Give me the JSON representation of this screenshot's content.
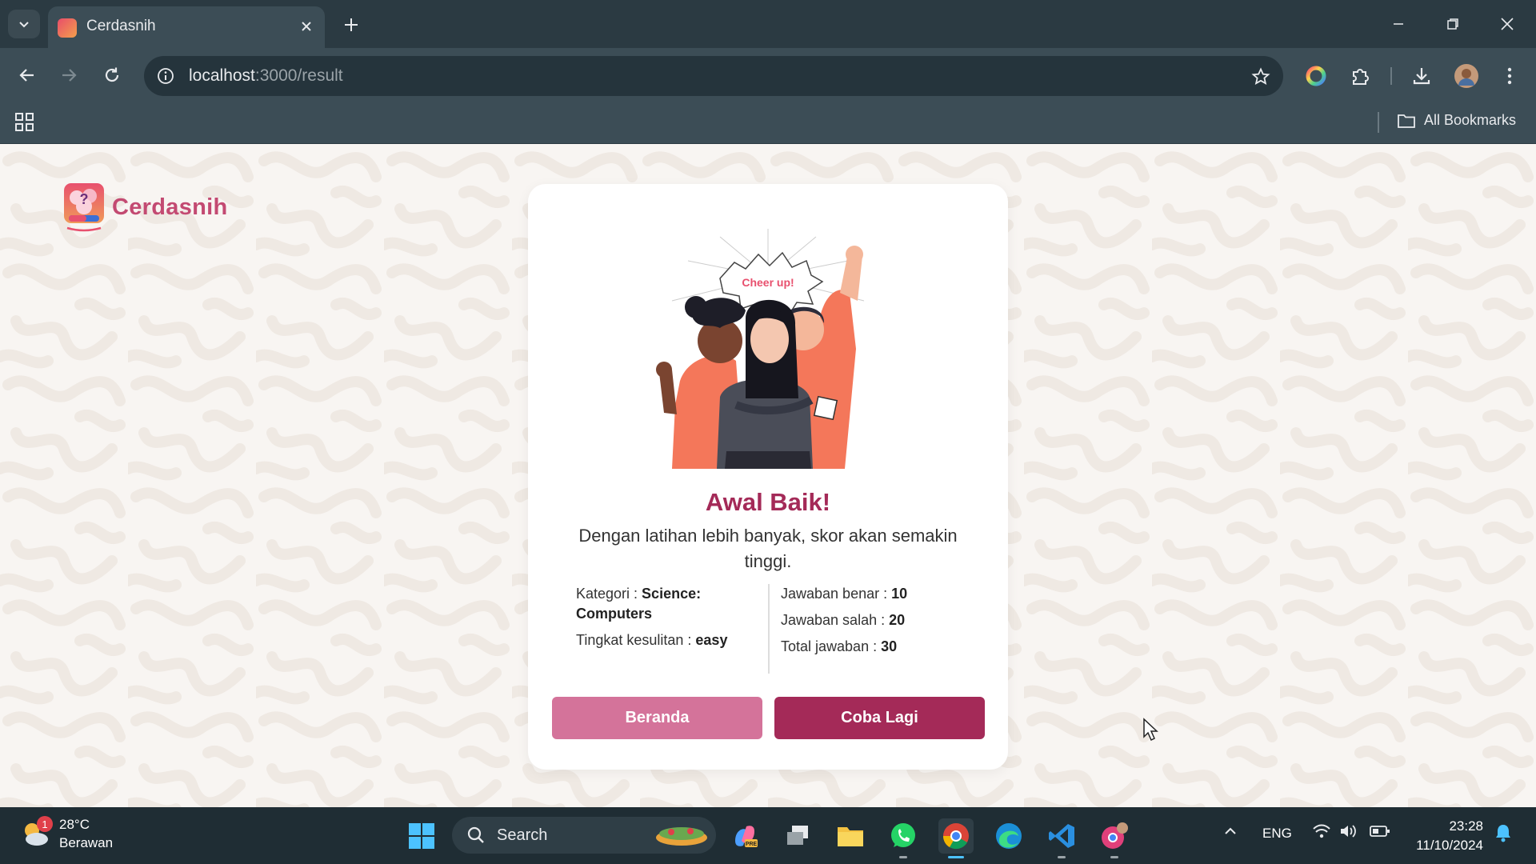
{
  "browser": {
    "tab_title": "Cerdasnih",
    "url_host": "localhost",
    "url_path": ":3000/result",
    "all_bookmarks": "All Bookmarks"
  },
  "page": {
    "logo_text": "Cerdasnih",
    "illustration_text": "Cheer up!",
    "heading": "Awal Baik!",
    "subtitle": "Dengan latihan lebih banyak, skor akan semakin tinggi.",
    "stats": {
      "category_label": "Kategori : ",
      "category_value": "Science: Computers",
      "difficulty_label": "Tingkat kesulitan : ",
      "difficulty_value": "easy",
      "correct_label": "Jawaban benar : ",
      "correct_value": "10",
      "wrong_label": "Jawaban salah : ",
      "wrong_value": "20",
      "total_label": "Total jawaban : ",
      "total_value": "30"
    },
    "buttons": {
      "home": "Beranda",
      "retry": "Coba Lagi"
    }
  },
  "taskbar": {
    "weather_temp": "28°C",
    "weather_desc": "Berawan",
    "weather_badge": "1",
    "search_label": "Search",
    "language": "ENG",
    "time": "23:28",
    "date": "11/10/2024"
  },
  "colors": {
    "accent": "#a42a58",
    "accent_light": "#d4739a",
    "logo": "#c34a72"
  }
}
